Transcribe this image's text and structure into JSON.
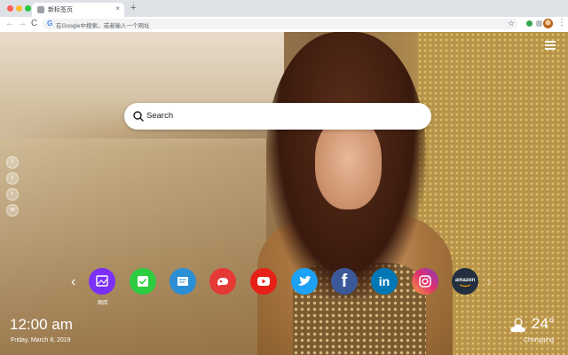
{
  "browser": {
    "tab_title": "新标签页",
    "tab_close": "×",
    "new_tab": "+",
    "omnibox_placeholder": "在Google中搜索，或者输入一个网址",
    "g_letter": "G",
    "back": "←",
    "forward": "→",
    "reload": "C",
    "star": "☆",
    "menu": "⋮"
  },
  "page": {
    "search": {
      "placeholder": "Search"
    },
    "shortcuts": [
      {
        "name": "gallery",
        "label": "图库",
        "color": "#7b2ff7",
        "icon": "image-icon"
      },
      {
        "name": "tasks",
        "label": "",
        "color": "#2ecc40",
        "icon": "checkmark-icon"
      },
      {
        "name": "notes",
        "label": "",
        "color": "#2b8fd6",
        "icon": "notepad-icon"
      },
      {
        "name": "games",
        "label": "",
        "color": "#e53935",
        "icon": "gamepad-icon"
      },
      {
        "name": "youtube",
        "label": "",
        "color": "#e62117",
        "icon": "play-icon"
      },
      {
        "name": "twitter",
        "label": "",
        "color": "#1da1f2",
        "icon": "bird-icon"
      },
      {
        "name": "facebook",
        "label": "",
        "color": "#3b5998",
        "icon": "facebook-icon"
      },
      {
        "name": "linkedin",
        "label": "",
        "color": "#0077b5",
        "icon": "linkedin-icon"
      },
      {
        "name": "instagram",
        "label": "",
        "color": "#c13584",
        "icon": "instagram-icon"
      },
      {
        "name": "amazon",
        "label": "amazon",
        "color": "#232f3e",
        "icon": "amazon-icon"
      }
    ],
    "shortcut_text": {
      "facebook": "f",
      "linkedin": "in",
      "amazon": "amazon"
    },
    "arrows": {
      "left": "‹",
      "right": "›"
    },
    "social": [
      {
        "name": "facebook",
        "glyph": "f"
      },
      {
        "name": "twitter",
        "glyph": "t"
      },
      {
        "name": "reddit",
        "glyph": "r"
      },
      {
        "name": "wechat",
        "glyph": "w"
      }
    ],
    "clock": {
      "time": "12:00 am",
      "date": "Friday, March 8, 2019"
    },
    "weather": {
      "temp": "24°",
      "city": "Chongqing",
      "icon": "partly-cloudy-icon"
    }
  }
}
